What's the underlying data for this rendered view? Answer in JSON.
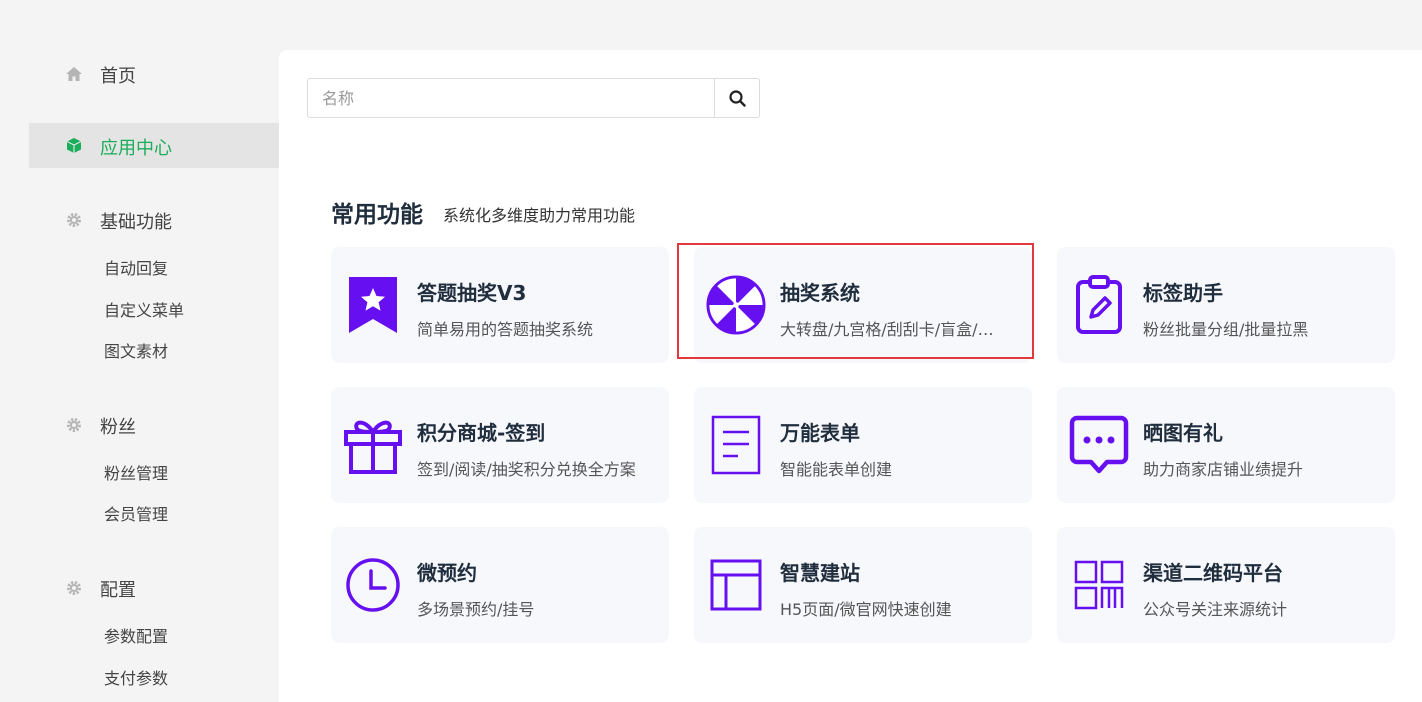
{
  "sidebar": {
    "home": "首页",
    "app_center": "应用中心",
    "basic": {
      "label": "基础功能",
      "items": [
        "自动回复",
        "自定义菜单",
        "图文素材"
      ]
    },
    "fans": {
      "label": "粉丝",
      "items": [
        "粉丝管理",
        "会员管理"
      ]
    },
    "config": {
      "label": "配置",
      "items": [
        "参数配置",
        "支付参数"
      ]
    }
  },
  "search": {
    "placeholder": "名称",
    "value": ""
  },
  "section": {
    "title": "常用功能",
    "subtitle": "系统化多维度助力常用功能"
  },
  "cards": [
    {
      "title": "答题抽奖V3",
      "desc": "简单易用的答题抽奖系统",
      "icon": "ribbon-star-icon"
    },
    {
      "title": "抽奖系统",
      "desc": "大转盘/九宫格/刮刮卡/盲盒/…",
      "icon": "lottery-wheel-icon",
      "highlighted": true
    },
    {
      "title": "标签助手",
      "desc": "粉丝批量分组/批量拉黑",
      "icon": "tag-clipboard-icon"
    },
    {
      "title": "积分商城-签到",
      "desc": "签到/阅读/抽奖积分兑换全方案",
      "icon": "gift-icon"
    },
    {
      "title": "万能表单",
      "desc": "智能能表单创建",
      "icon": "form-document-icon"
    },
    {
      "title": "晒图有礼",
      "desc": "助力商家店铺业绩提升",
      "icon": "chat-bubble-icon"
    },
    {
      "title": "微预约",
      "desc": "多场景预约/挂号",
      "icon": "clock-icon"
    },
    {
      "title": "智慧建站",
      "desc": "H5页面/微官网快速创建",
      "icon": "layout-icon"
    },
    {
      "title": "渠道二维码平台",
      "desc": "公众号关注来源统计",
      "icon": "qrcode-grid-icon"
    }
  ],
  "colors": {
    "accent": "#6610f2",
    "active_green": "#1aad5a",
    "highlight_border": "#e0393e"
  }
}
